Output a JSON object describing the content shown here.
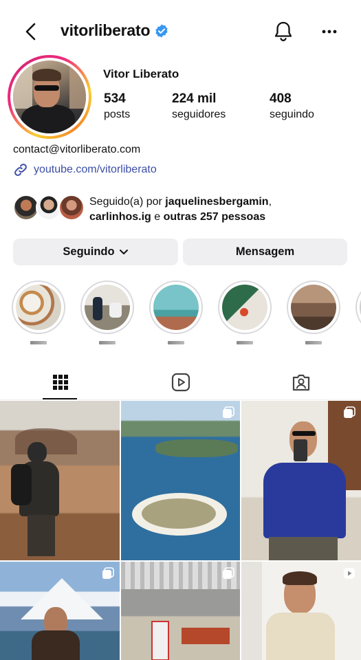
{
  "header": {
    "username": "vitorliberato",
    "verified": true,
    "back_icon": "chevron-left-icon",
    "notifications_icon": "bell-icon",
    "more_icon": "more-horizontal-icon"
  },
  "profile": {
    "full_name": "Vitor Liberato",
    "stats": [
      {
        "value": "534",
        "label": "posts"
      },
      {
        "value": "224 mil",
        "label": "seguidores"
      },
      {
        "value": "408",
        "label": "seguindo"
      }
    ],
    "email": "contact@vitorliberato.com",
    "link": "youtube.com/vitorliberato"
  },
  "followed_by": {
    "prefix": "Seguido(a) por ",
    "user1": "jaquelinesbergamin",
    "sep": ",",
    "user2": "carlinhos.ig",
    "mid": " e ",
    "others": "outras 257 pessoas"
  },
  "actions": {
    "following_label": "Seguindo",
    "message_label": "Mensagem"
  },
  "tabs": [
    "posts-grid",
    "reels",
    "tagged"
  ],
  "colors": {
    "accent_link": "#3b4ea6",
    "verified_blue": "#3897f0",
    "button_bg": "#efeff2"
  }
}
